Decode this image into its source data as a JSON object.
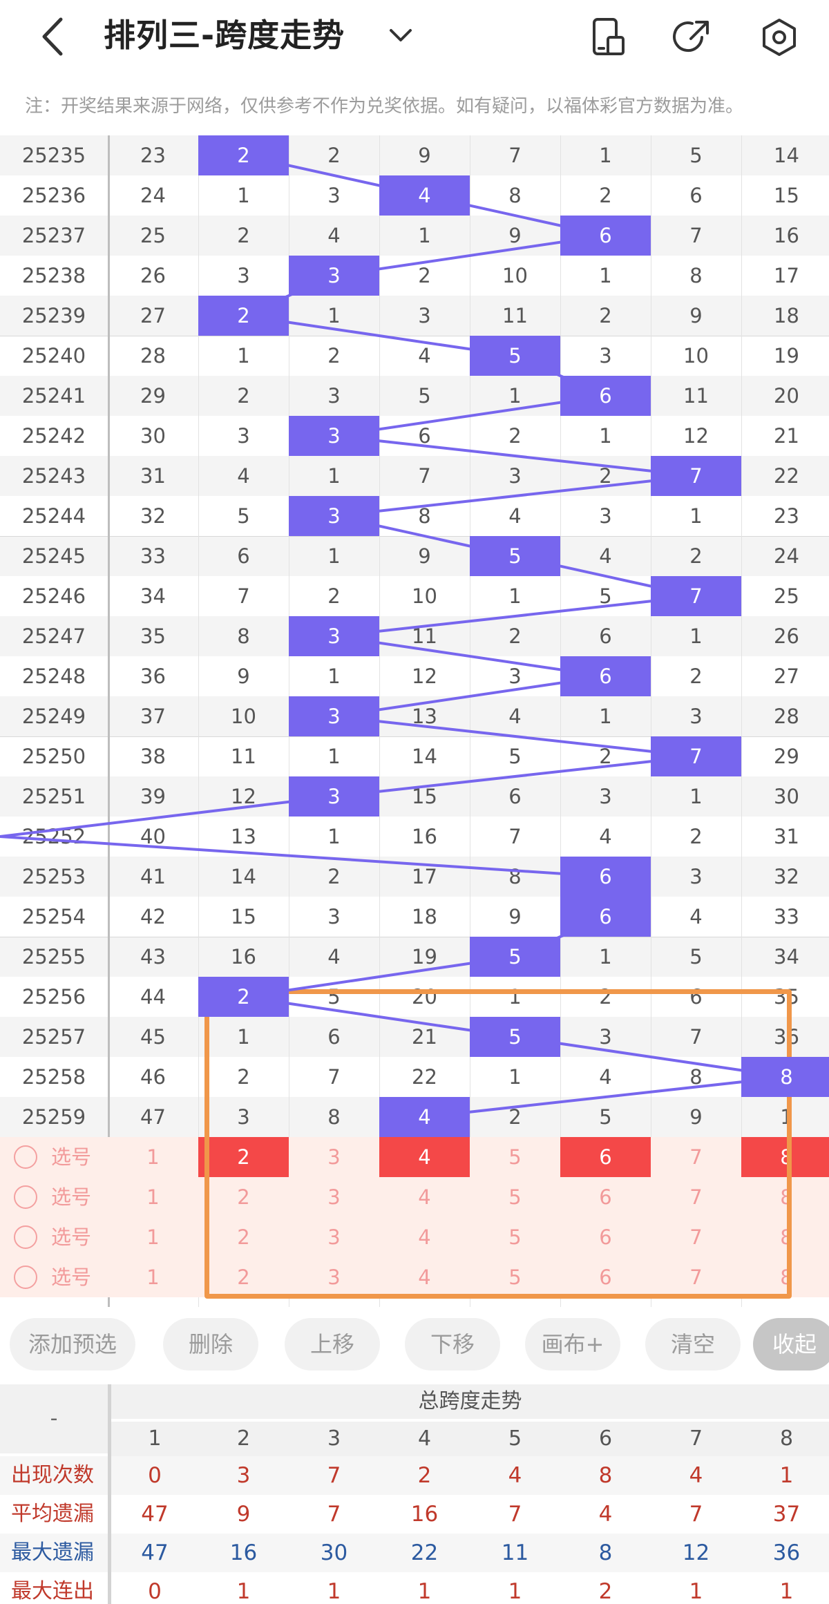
{
  "header": {
    "title": "排列三-跨度走势",
    "icons": [
      "back-arrow-icon",
      "chevron-down-icon",
      "phone-layout-icon",
      "share-icon",
      "settings-icon"
    ]
  },
  "notice": "注：开奖结果来源于网络，仅供参考不作为兑奖依据。如有疑问，以福体彩官方数据为准。",
  "colors": {
    "hit": "#7766ee",
    "line": "#7766ee",
    "selected": "#f44848",
    "highlight_box": "#f0974a",
    "stat_count": "#c0392b",
    "stat_max": "#2c5aa0"
  },
  "rows": [
    {
      "issue": "25235",
      "c0": "23",
      "spans": [
        "2",
        "2",
        "9",
        "7",
        "1",
        "5",
        "14"
      ],
      "hit": 0
    },
    {
      "issue": "25236",
      "c0": "24",
      "spans": [
        "1",
        "3",
        "4",
        "8",
        "2",
        "6",
        "15"
      ],
      "hit": 2
    },
    {
      "issue": "25237",
      "c0": "25",
      "spans": [
        "2",
        "4",
        "1",
        "9",
        "6",
        "7",
        "16"
      ],
      "hit": 4
    },
    {
      "issue": "25238",
      "c0": "26",
      "spans": [
        "3",
        "3",
        "2",
        "10",
        "1",
        "8",
        "17"
      ],
      "hit": 1
    },
    {
      "issue": "25239",
      "c0": "27",
      "spans": [
        "2",
        "1",
        "3",
        "11",
        "2",
        "9",
        "18"
      ],
      "hit": 0
    },
    {
      "issue": "25240",
      "c0": "28",
      "spans": [
        "1",
        "2",
        "4",
        "5",
        "3",
        "10",
        "19"
      ],
      "hit": 3
    },
    {
      "issue": "25241",
      "c0": "29",
      "spans": [
        "2",
        "3",
        "5",
        "1",
        "6",
        "11",
        "20"
      ],
      "hit": 4
    },
    {
      "issue": "25242",
      "c0": "30",
      "spans": [
        "3",
        "3",
        "6",
        "2",
        "1",
        "12",
        "21"
      ],
      "hit": 1
    },
    {
      "issue": "25243",
      "c0": "31",
      "spans": [
        "4",
        "1",
        "7",
        "3",
        "2",
        "7",
        "22"
      ],
      "hit": 5
    },
    {
      "issue": "25244",
      "c0": "32",
      "spans": [
        "5",
        "3",
        "8",
        "4",
        "3",
        "1",
        "23"
      ],
      "hit": 1
    },
    {
      "issue": "25245",
      "c0": "33",
      "spans": [
        "6",
        "1",
        "9",
        "5",
        "4",
        "2",
        "24"
      ],
      "hit": 3
    },
    {
      "issue": "25246",
      "c0": "34",
      "spans": [
        "7",
        "2",
        "10",
        "1",
        "5",
        "7",
        "25"
      ],
      "hit": 5
    },
    {
      "issue": "25247",
      "c0": "35",
      "spans": [
        "8",
        "3",
        "11",
        "2",
        "6",
        "1",
        "26"
      ],
      "hit": 1
    },
    {
      "issue": "25248",
      "c0": "36",
      "spans": [
        "9",
        "1",
        "12",
        "3",
        "6",
        "2",
        "27"
      ],
      "hit": 4
    },
    {
      "issue": "25249",
      "c0": "37",
      "spans": [
        "10",
        "3",
        "13",
        "4",
        "1",
        "3",
        "28"
      ],
      "hit": 1
    },
    {
      "issue": "25250",
      "c0": "38",
      "spans": [
        "11",
        "1",
        "14",
        "5",
        "2",
        "7",
        "29"
      ],
      "hit": 5
    },
    {
      "issue": "25251",
      "c0": "39",
      "spans": [
        "12",
        "3",
        "15",
        "6",
        "3",
        "1",
        "30"
      ],
      "hit": 1
    },
    {
      "issue": "25252",
      "c0": "40",
      "spans": [
        "13",
        "1",
        "16",
        "7",
        "4",
        "2",
        "31"
      ],
      "hit": 7
    },
    {
      "issue": "25253",
      "c0": "41",
      "spans": [
        "14",
        "2",
        "17",
        "8",
        "6",
        "3",
        "32"
      ],
      "hit": 4
    },
    {
      "issue": "25254",
      "c0": "42",
      "spans": [
        "15",
        "3",
        "18",
        "9",
        "6",
        "4",
        "33"
      ],
      "hit": 4
    },
    {
      "issue": "25255",
      "c0": "43",
      "spans": [
        "16",
        "4",
        "19",
        "5",
        "1",
        "5",
        "34"
      ],
      "hit": 3
    },
    {
      "issue": "25256",
      "c0": "44",
      "spans": [
        "2",
        "5",
        "20",
        "1",
        "2",
        "6",
        "35"
      ],
      "hit": 0
    },
    {
      "issue": "25257",
      "c0": "45",
      "spans": [
        "1",
        "6",
        "21",
        "5",
        "3",
        "7",
        "36"
      ],
      "hit": 3
    },
    {
      "issue": "25258",
      "c0": "46",
      "spans": [
        "2",
        "7",
        "22",
        "1",
        "4",
        "8",
        "8"
      ],
      "hit": 6
    },
    {
      "issue": "25259",
      "c0": "47",
      "spans": [
        "3",
        "8",
        "4",
        "2",
        "5",
        "9",
        "1"
      ],
      "hit": 2
    }
  ],
  "pick_rows": [
    {
      "label": "选号",
      "c0": "1",
      "nums": [
        "2",
        "3",
        "4",
        "5",
        "6",
        "7",
        "8"
      ],
      "selected": [
        0,
        2,
        4,
        6
      ]
    },
    {
      "label": "选号",
      "c0": "1",
      "nums": [
        "2",
        "3",
        "4",
        "5",
        "6",
        "7",
        "8"
      ],
      "selected": []
    },
    {
      "label": "选号",
      "c0": "1",
      "nums": [
        "2",
        "3",
        "4",
        "5",
        "6",
        "7",
        "8"
      ],
      "selected": []
    },
    {
      "label": "选号",
      "c0": "1",
      "nums": [
        "2",
        "3",
        "4",
        "5",
        "6",
        "7",
        "8"
      ],
      "selected": []
    }
  ],
  "toolbar": {
    "add": "添加预选",
    "delete": "删除",
    "up": "上移",
    "down": "下移",
    "canvas": "画布+",
    "clear": "清空",
    "collapse": "收起"
  },
  "stats": {
    "corner": "-",
    "header": "总跨度走势",
    "columns": [
      "1",
      "2",
      "3",
      "4",
      "5",
      "6",
      "7",
      "8"
    ],
    "rows": [
      {
        "label": "出现次数",
        "values": [
          "0",
          "3",
          "7",
          "2",
          "4",
          "8",
          "4",
          "1"
        ]
      },
      {
        "label": "平均遗漏",
        "values": [
          "47",
          "9",
          "7",
          "16",
          "7",
          "4",
          "7",
          "37"
        ]
      },
      {
        "label": "最大遗漏",
        "values": [
          "47",
          "16",
          "30",
          "22",
          "11",
          "8",
          "12",
          "36"
        ]
      },
      {
        "label": "最大连出",
        "values": [
          "0",
          "1",
          "1",
          "1",
          "1",
          "2",
          "1",
          "1"
        ]
      }
    ]
  }
}
